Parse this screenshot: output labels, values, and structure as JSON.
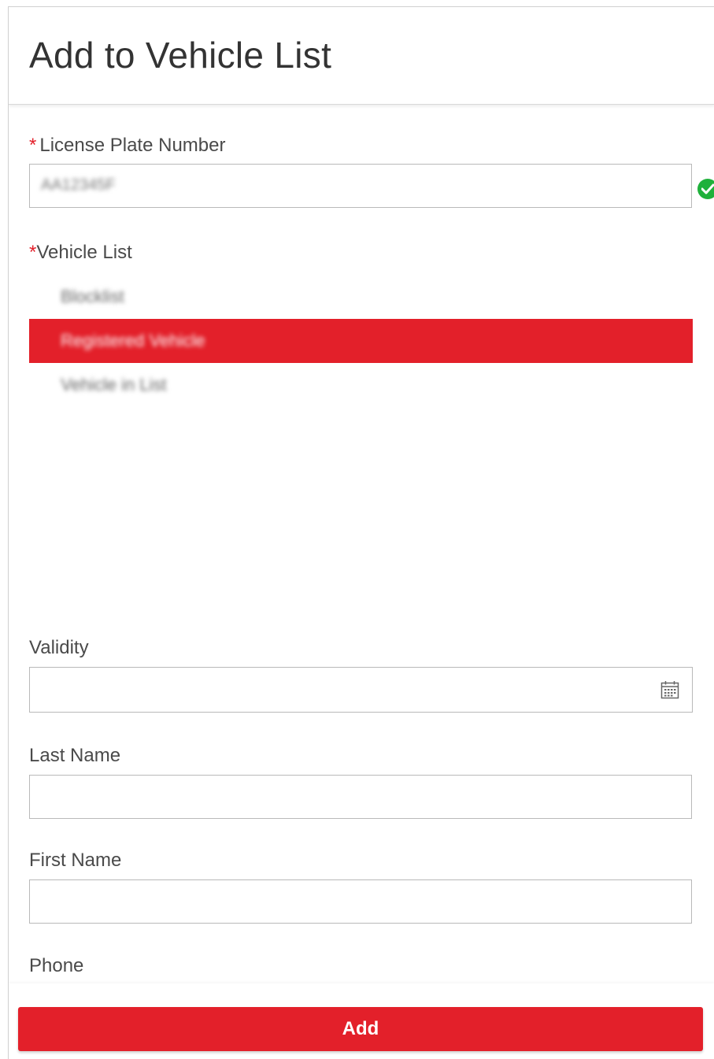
{
  "header": {
    "title": "Add to Vehicle List"
  },
  "form": {
    "license_plate": {
      "required_mark": "*",
      "label": "License Plate Number",
      "value": "AA12345F"
    },
    "vehicle_list": {
      "required_mark": "*",
      "label": "Vehicle List",
      "options": [
        "Blocklist",
        "Registered Vehicle",
        "Vehicle in List"
      ],
      "selected": "Registered Vehicle"
    },
    "validity": {
      "label": "Validity",
      "value": ""
    },
    "last_name": {
      "label": "Last Name",
      "value": ""
    },
    "first_name": {
      "label": "First Name",
      "value": ""
    },
    "phone": {
      "label": "Phone",
      "value": ""
    }
  },
  "footer": {
    "add_label": "Add"
  },
  "colors": {
    "accent": "#e3202a",
    "success": "#1fb13b"
  }
}
